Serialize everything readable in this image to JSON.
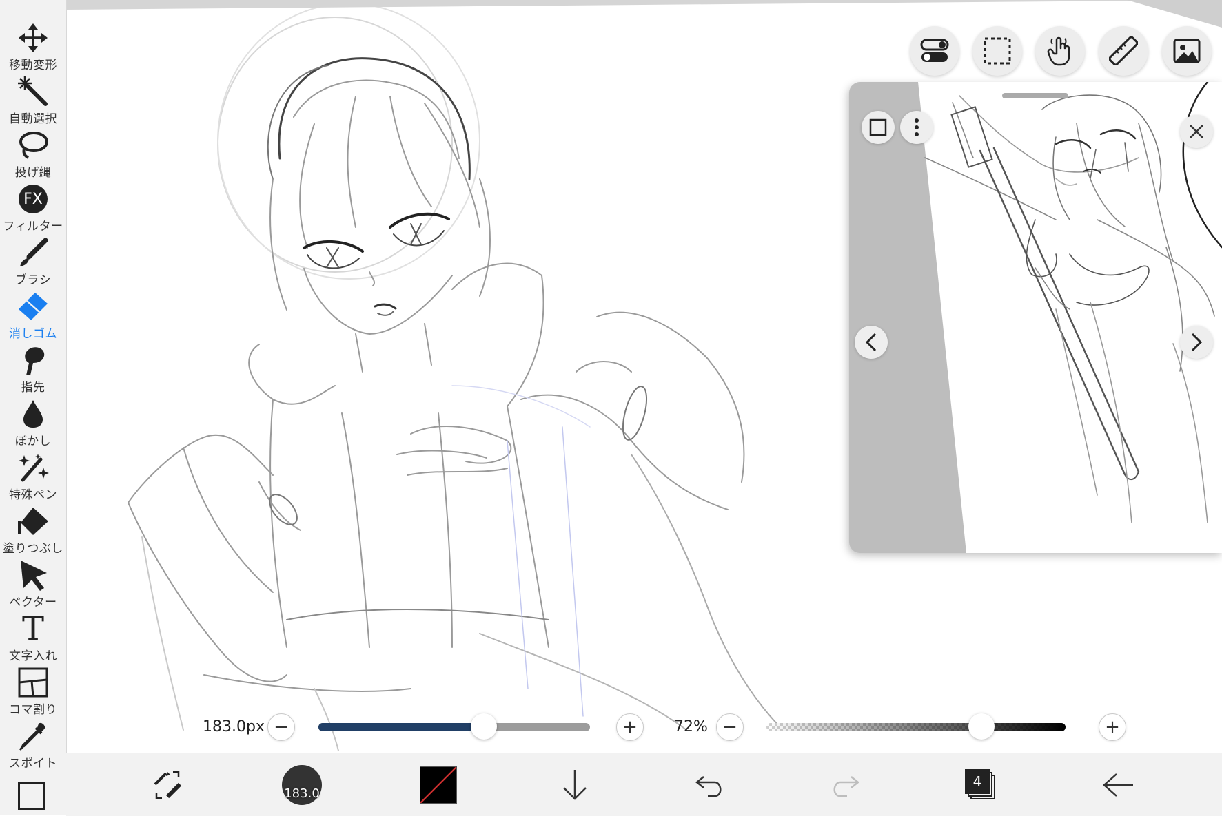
{
  "toolbar": {
    "tools": [
      {
        "label": "移動変形",
        "icon": "move-arrows-icon"
      },
      {
        "label": "自動選択",
        "icon": "magic-wand-icon"
      },
      {
        "label": "投げ縄",
        "icon": "lasso-icon"
      },
      {
        "label": "フィルター",
        "icon": "fx-filter-icon",
        "badge": "FX"
      },
      {
        "label": "ブラシ",
        "icon": "brush-icon"
      },
      {
        "label": "消しゴム",
        "icon": "eraser-icon",
        "active": true
      },
      {
        "label": "指先",
        "icon": "finger-smudge-icon"
      },
      {
        "label": "ぼかし",
        "icon": "blur-drop-icon"
      },
      {
        "label": "特殊ペン",
        "icon": "special-pen-icon"
      },
      {
        "label": "塗りつぶし",
        "icon": "fill-bucket-icon"
      },
      {
        "label": "ベクター",
        "icon": "vector-arrow-icon"
      },
      {
        "label": "文字入れ",
        "icon": "text-icon",
        "glyph": "T"
      },
      {
        "label": "コマ割り",
        "icon": "frame-divider-icon"
      },
      {
        "label": "スポイト",
        "icon": "eyedropper-icon"
      }
    ],
    "bottom_icon": "canvas-frame-icon"
  },
  "top_actions": [
    {
      "name": "toggle-settings-button",
      "icon": "toggle-switch-icon"
    },
    {
      "name": "selection-button",
      "icon": "dashed-selection-icon"
    },
    {
      "name": "hand-button",
      "icon": "hand-pointer-icon"
    },
    {
      "name": "ruler-button",
      "icon": "ruler-icon"
    },
    {
      "name": "material-button",
      "icon": "image-icon"
    }
  ],
  "reference_panel": {
    "buttons": [
      "square-view-icon",
      "more-dots-icon",
      "close-icon",
      "chevron-left-icon",
      "chevron-right-icon"
    ]
  },
  "brush_size": {
    "value_label": "183.0px",
    "level": 0.61
  },
  "opacity": {
    "value_label": "72%",
    "level": 0.72
  },
  "bottom_bar": {
    "brush_preview_label": "183.0",
    "layer_count": "4",
    "color_primary": "#000000",
    "color_secondary": "#d23030"
  },
  "colors": {
    "accent": "#1a7ff0",
    "size_track": "#213f66"
  }
}
